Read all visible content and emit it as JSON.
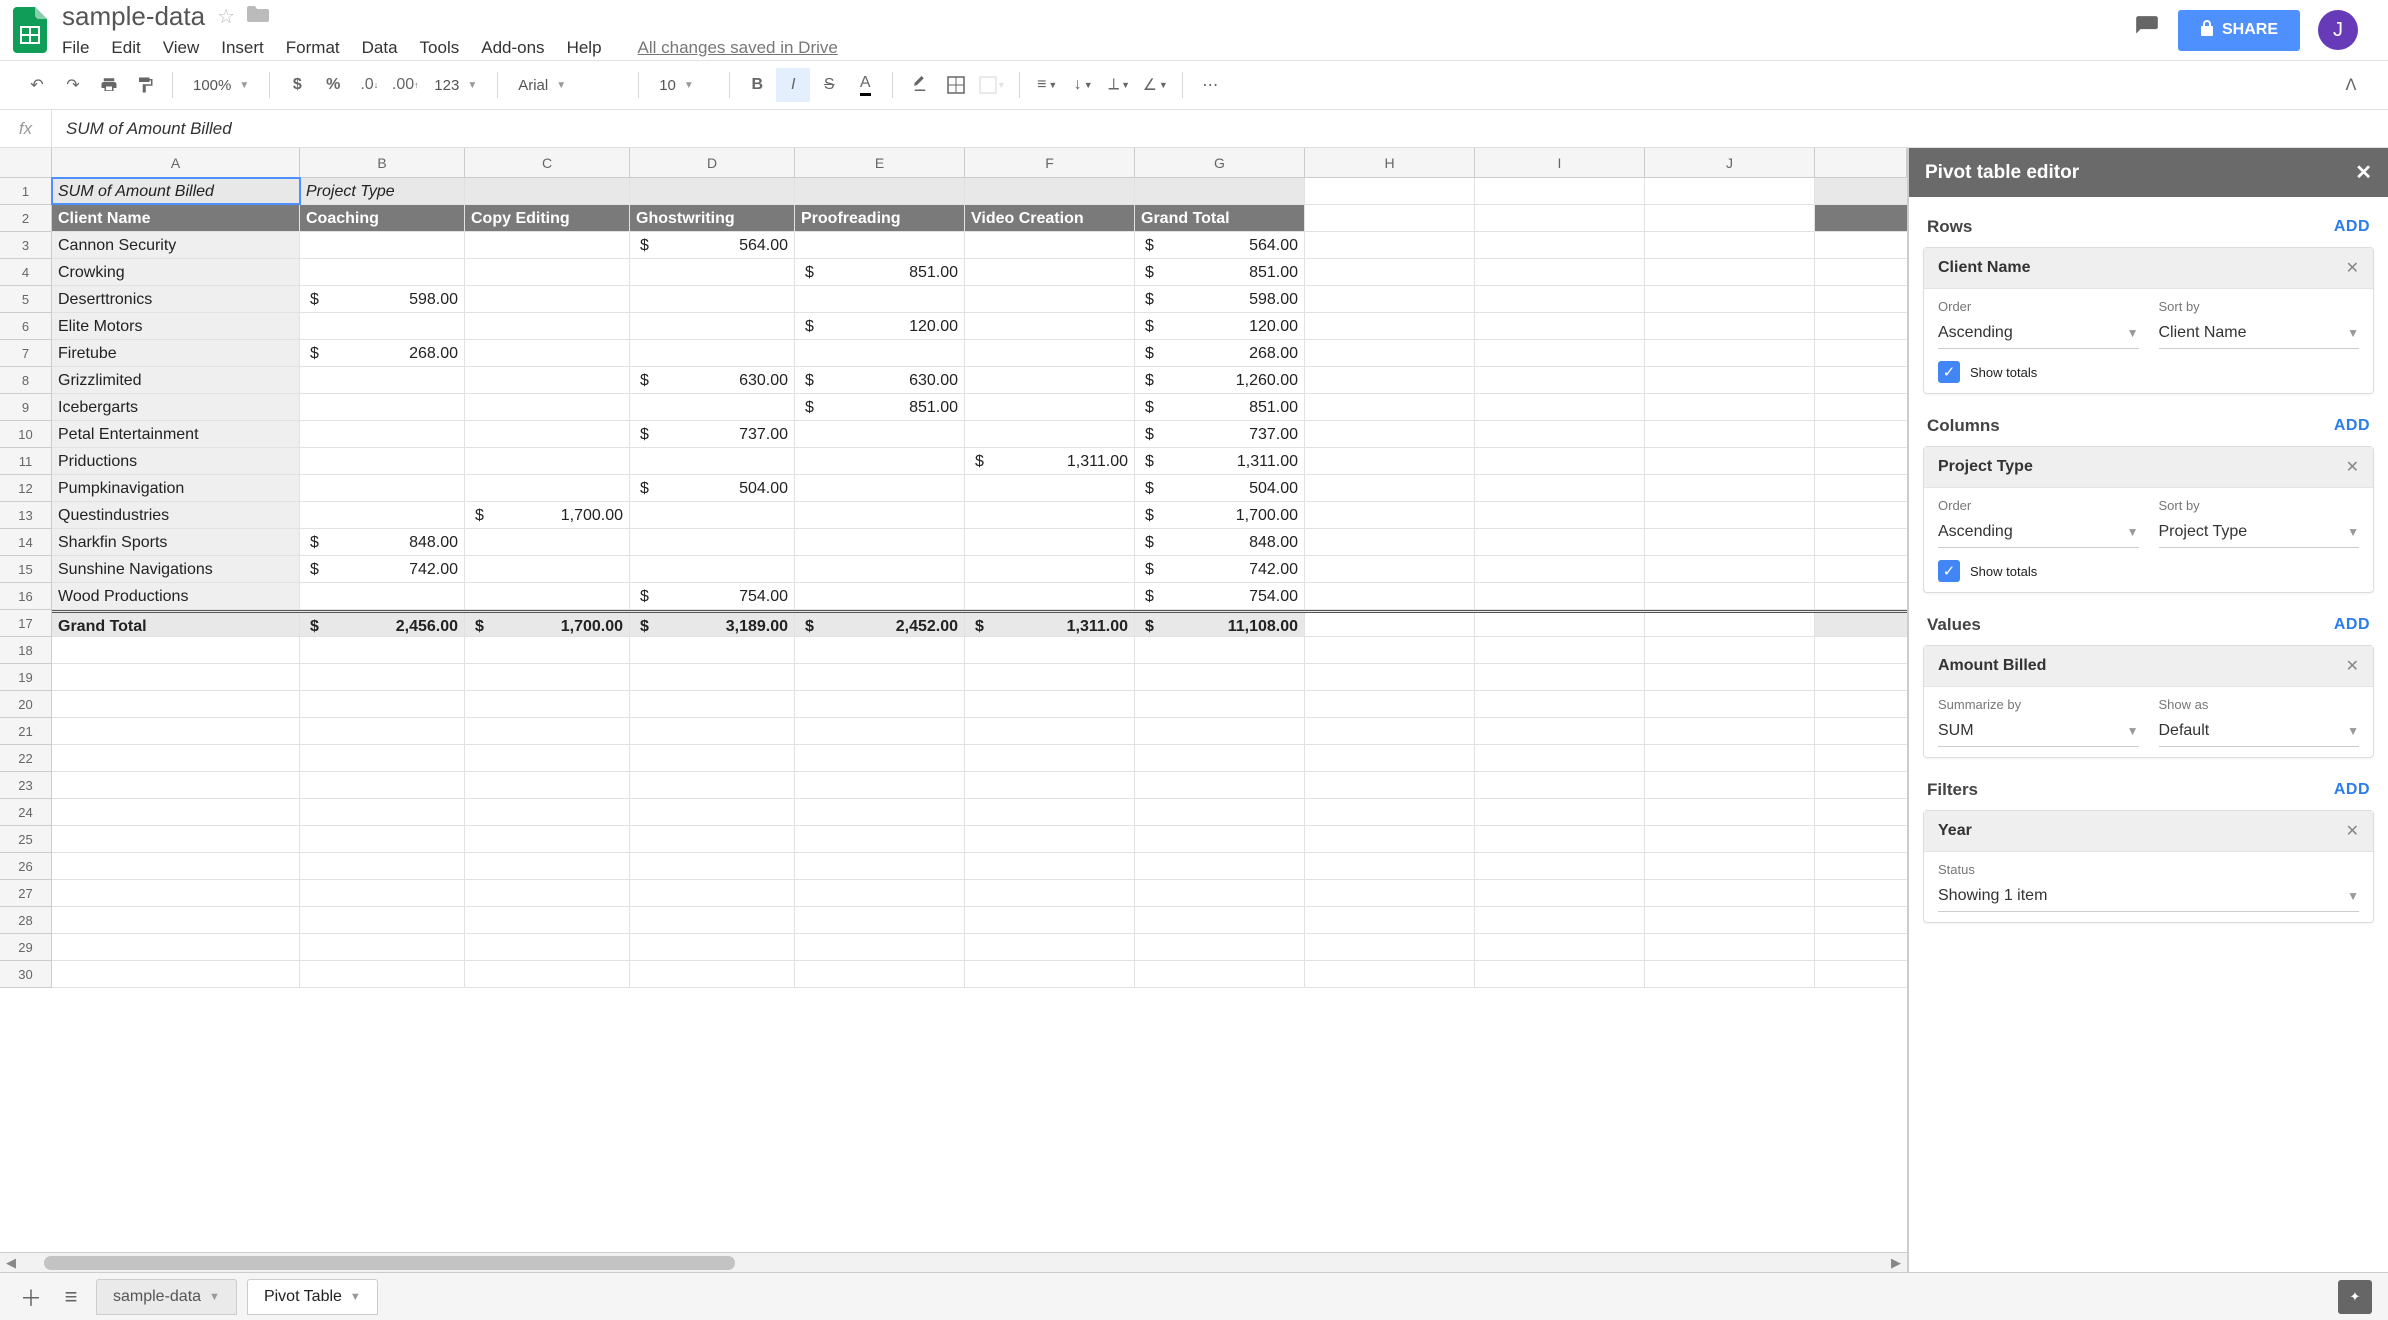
{
  "header": {
    "doc_title": "sample-data",
    "menu": [
      "File",
      "Edit",
      "View",
      "Insert",
      "Format",
      "Data",
      "Tools",
      "Add-ons",
      "Help"
    ],
    "saved_text": "All changes saved in Drive",
    "share_label": "SHARE",
    "avatar_letter": "J"
  },
  "toolbar": {
    "zoom": "100%",
    "font": "Arial",
    "font_size": "10",
    "number_format": "123"
  },
  "formula_bar": {
    "fx": "fx",
    "content": "SUM of  Amount Billed"
  },
  "columns": [
    "A",
    "B",
    "C",
    "D",
    "E",
    "F",
    "G",
    "H",
    "I",
    "J"
  ],
  "pivot_table": {
    "corner_label": "SUM of  Amount Billed",
    "col_super_label": "Project Type",
    "row_header_label": "Client Name",
    "col_headers": [
      "Coaching",
      "Copy Editing",
      "Ghostwriting",
      "Proofreading",
      "Video Creation",
      "Grand Total"
    ],
    "rows": [
      {
        "client": "Cannon Security",
        "cells": [
          "",
          "",
          "564.00",
          "",
          "",
          "564.00"
        ]
      },
      {
        "client": "Crowking",
        "cells": [
          "",
          "",
          "",
          "851.00",
          "",
          "851.00"
        ]
      },
      {
        "client": "Deserttronics",
        "cells": [
          "598.00",
          "",
          "",
          "",
          "",
          "598.00"
        ]
      },
      {
        "client": "Elite Motors",
        "cells": [
          "",
          "",
          "",
          "120.00",
          "",
          "120.00"
        ]
      },
      {
        "client": "Firetube",
        "cells": [
          "268.00",
          "",
          "",
          "",
          "",
          "268.00"
        ]
      },
      {
        "client": "Grizzlimited",
        "cells": [
          "",
          "",
          "630.00",
          "630.00",
          "",
          "1,260.00"
        ]
      },
      {
        "client": "Icebergarts",
        "cells": [
          "",
          "",
          "",
          "851.00",
          "",
          "851.00"
        ]
      },
      {
        "client": "Petal Entertainment",
        "cells": [
          "",
          "",
          "737.00",
          "",
          "",
          "737.00"
        ]
      },
      {
        "client": "Priductions",
        "cells": [
          "",
          "",
          "",
          "",
          "1,311.00",
          "1,311.00"
        ]
      },
      {
        "client": "Pumpkinavigation",
        "cells": [
          "",
          "",
          "504.00",
          "",
          "",
          "504.00"
        ]
      },
      {
        "client": "Questindustries",
        "cells": [
          "",
          "1,700.00",
          "",
          "",
          "",
          "1,700.00"
        ]
      },
      {
        "client": "Sharkfin Sports",
        "cells": [
          "848.00",
          "",
          "",
          "",
          "",
          "848.00"
        ]
      },
      {
        "client": "Sunshine Navigations",
        "cells": [
          "742.00",
          "",
          "",
          "",
          "",
          "742.00"
        ]
      },
      {
        "client": "Wood Productions",
        "cells": [
          "",
          "",
          "754.00",
          "",
          "",
          "754.00"
        ]
      }
    ],
    "grand_total_label": "Grand Total",
    "grand_totals": [
      "2,456.00",
      "1,700.00",
      "3,189.00",
      "2,452.00",
      "1,311.00",
      "11,108.00"
    ]
  },
  "row_numbers_empty": [
    18,
    19,
    20,
    21,
    22,
    23,
    24,
    25,
    26,
    27,
    28,
    29,
    30
  ],
  "sheets": {
    "inactive": "sample-data",
    "active": "Pivot Table"
  },
  "pivot_editor": {
    "title": "Pivot table editor",
    "add_label": "ADD",
    "sections": {
      "rows": "Rows",
      "columns": "Columns",
      "values": "Values",
      "filters": "Filters"
    },
    "rows_card": {
      "title": "Client Name",
      "order_label": "Order",
      "order_value": "Ascending",
      "sort_label": "Sort by",
      "sort_value": "Client Name",
      "show_totals": "Show totals"
    },
    "cols_card": {
      "title": "Project Type",
      "order_label": "Order",
      "order_value": "Ascending",
      "sort_label": "Sort by",
      "sort_value": "Project Type",
      "show_totals": "Show totals"
    },
    "values_card": {
      "title": "Amount Billed",
      "summarize_label": "Summarize by",
      "summarize_value": "SUM",
      "showas_label": "Show as",
      "showas_value": "Default"
    },
    "filters_card": {
      "title": "Year",
      "status_label": "Status",
      "status_value": "Showing 1 item"
    }
  }
}
